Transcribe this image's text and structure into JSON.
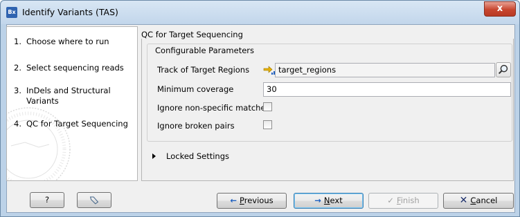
{
  "window": {
    "title": "Identify Variants (TAS)",
    "app_icon_text": "Bx",
    "close_symbol": "x"
  },
  "steps": [
    {
      "num": "1.",
      "label": "Choose where to run"
    },
    {
      "num": "2.",
      "label": "Select sequencing reads"
    },
    {
      "num": "3.",
      "label": "InDels and Structural Variants"
    },
    {
      "num": "4.",
      "label": "QC for Target Sequencing"
    }
  ],
  "panel": {
    "title": "QC for Target Sequencing",
    "group_title": "Configurable Parameters",
    "track_label": "Track of Target Regions",
    "track_value": "target_regions",
    "min_cov_label": "Minimum coverage",
    "min_cov_value": "30",
    "ignore_nonspecific_label": "Ignore non-specific matches",
    "ignore_nonspecific_checked": false,
    "ignore_broken_label": "Ignore broken pairs",
    "ignore_broken_checked": false,
    "locked_label": "Locked Settings"
  },
  "buttons": {
    "help": "?",
    "previous_prefix": "",
    "previous_u": "P",
    "previous_rest": "revious",
    "next_u": "N",
    "next_rest": "ext",
    "finish_u": "F",
    "finish_rest": "inish",
    "cancel_u": "C",
    "cancel_rest": "ancel"
  },
  "colors": {
    "accent_arrow": "#1d5fbf",
    "cancel_x": "#1c2f6b",
    "icon_yellow": "#e6b000"
  }
}
